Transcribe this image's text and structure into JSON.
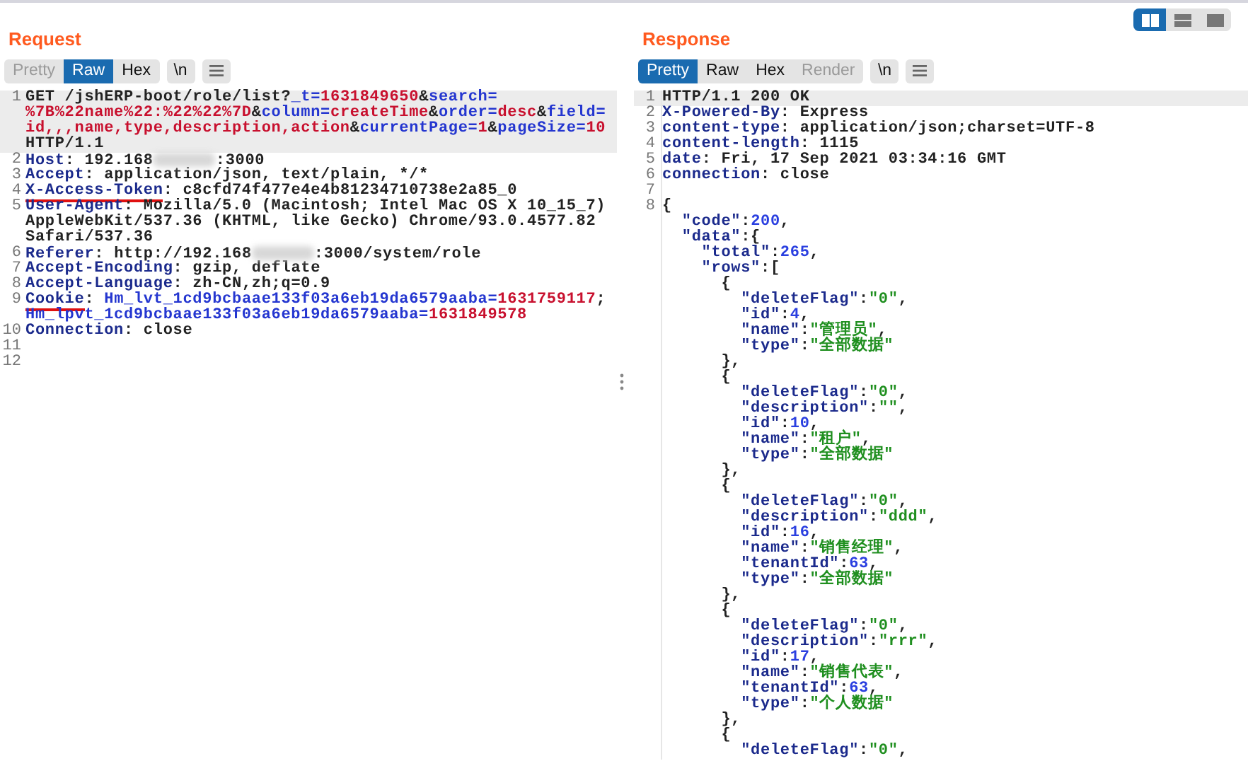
{
  "request": {
    "title": "Request",
    "tabs": [
      {
        "label": "Pretty",
        "selected": false,
        "disabled": true
      },
      {
        "label": "Raw",
        "selected": true,
        "disabled": false
      },
      {
        "label": "Hex",
        "selected": false,
        "disabled": false
      }
    ],
    "newline_button": "\\n",
    "lines": [
      {
        "number": "1",
        "highlighted": true,
        "rows": [
          {
            "segments": [
              {
                "kind": "plain",
                "text": "GET /jshERP-boot/role/list?"
              },
              {
                "kind": "param",
                "text": "_t="
              },
              {
                "kind": "value",
                "text": "1631849650"
              },
              {
                "kind": "plain",
                "text": "&"
              },
              {
                "kind": "param",
                "text": "search="
              }
            ]
          },
          {
            "segments": [
              {
                "kind": "value",
                "text": "%7B%22name%22:%22%22%7D"
              },
              {
                "kind": "plain",
                "text": "&"
              },
              {
                "kind": "param",
                "text": "column="
              },
              {
                "kind": "value",
                "text": "createTime"
              },
              {
                "kind": "plain",
                "text": "&"
              },
              {
                "kind": "param",
                "text": "order="
              },
              {
                "kind": "value",
                "text": "desc"
              },
              {
                "kind": "plain",
                "text": "&"
              },
              {
                "kind": "param",
                "text": "field="
              }
            ]
          },
          {
            "segments": [
              {
                "kind": "value",
                "text": "id,,,name,type,description,action"
              },
              {
                "kind": "plain",
                "text": "&"
              },
              {
                "kind": "param",
                "text": "currentPage="
              },
              {
                "kind": "value",
                "text": "1"
              },
              {
                "kind": "plain",
                "text": "&"
              },
              {
                "kind": "param",
                "text": "pageSize="
              },
              {
                "kind": "value",
                "text": "10"
              }
            ]
          },
          {
            "segments": [
              {
                "kind": "plain",
                "text": "HTTP/1.1"
              }
            ]
          }
        ]
      },
      {
        "number": "2",
        "highlighted": false,
        "rows": [
          {
            "segments": [
              {
                "kind": "key",
                "text": "Host"
              },
              {
                "kind": "plain",
                "text": ": 192.168"
              },
              {
                "kind": "blur"
              },
              {
                "kind": "plain",
                "text": ":3000"
              }
            ]
          }
        ]
      },
      {
        "number": "3",
        "highlighted": false,
        "rows": [
          {
            "segments": [
              {
                "kind": "key",
                "text": "Accept"
              },
              {
                "kind": "plain",
                "text": ": application/json, text/plain, */*"
              }
            ]
          }
        ]
      },
      {
        "number": "4",
        "highlighted": false,
        "rows": [
          {
            "segments": [
              {
                "kind": "key",
                "text": "X-Access-Token",
                "underlined": true
              },
              {
                "kind": "plain",
                "text": ": c8cfd74f477e4e4b81234710738e2a85_0"
              }
            ]
          }
        ]
      },
      {
        "number": "5",
        "highlighted": false,
        "rows": [
          {
            "segments": [
              {
                "kind": "key",
                "text": "User-Agent"
              },
              {
                "kind": "plain",
                "text": ": Mozilla/5.0 (Macintosh; Intel Mac OS X 10_15_7)"
              }
            ]
          },
          {
            "segments": [
              {
                "kind": "plain",
                "text": "AppleWebKit/537.36 (KHTML, like Gecko) Chrome/93.0.4577.82"
              }
            ]
          },
          {
            "segments": [
              {
                "kind": "plain",
                "text": "Safari/537.36"
              }
            ]
          }
        ]
      },
      {
        "number": "6",
        "highlighted": false,
        "rows": [
          {
            "segments": [
              {
                "kind": "key",
                "text": "Referer"
              },
              {
                "kind": "plain",
                "text": ": http://192.168"
              },
              {
                "kind": "blur"
              },
              {
                "kind": "plain",
                "text": ":3000/system/role"
              }
            ]
          }
        ]
      },
      {
        "number": "7",
        "highlighted": false,
        "rows": [
          {
            "segments": [
              {
                "kind": "key",
                "text": "Accept-Encoding"
              },
              {
                "kind": "plain",
                "text": ": gzip, deflate"
              }
            ]
          }
        ]
      },
      {
        "number": "8",
        "highlighted": false,
        "rows": [
          {
            "segments": [
              {
                "kind": "key",
                "text": "Accept-Language"
              },
              {
                "kind": "plain",
                "text": ": zh-CN,zh;q=0.9"
              }
            ]
          }
        ]
      },
      {
        "number": "9",
        "highlighted": false,
        "rows": [
          {
            "segments": [
              {
                "kind": "key",
                "text": "Cookie",
                "underlined": true
              },
              {
                "kind": "plain",
                "text": ": "
              },
              {
                "kind": "param",
                "text": "Hm_lvt_1cd9bcbaae133f03a6eb19da6579aaba="
              },
              {
                "kind": "value",
                "text": "1631759117"
              },
              {
                "kind": "plain",
                "text": ";"
              }
            ]
          },
          {
            "segments": [
              {
                "kind": "param",
                "text": "Hm_lpvt_1cd9bcbaae133f03a6eb19da6579aaba="
              },
              {
                "kind": "value",
                "text": "1631849578"
              }
            ]
          }
        ]
      },
      {
        "number": "10",
        "highlighted": false,
        "rows": [
          {
            "segments": [
              {
                "kind": "key",
                "text": "Connection"
              },
              {
                "kind": "plain",
                "text": ": close"
              }
            ]
          }
        ]
      },
      {
        "number": "11",
        "highlighted": false
      },
      {
        "number": "12",
        "highlighted": false
      }
    ]
  },
  "response": {
    "title": "Response",
    "layout_buttons": [
      {
        "selected": true
      },
      {
        "selected": false
      },
      {
        "selected": false
      }
    ],
    "tabs": [
      {
        "label": "Pretty",
        "selected": true,
        "disabled": false
      },
      {
        "label": "Raw",
        "selected": false,
        "disabled": false
      },
      {
        "label": "Hex",
        "selected": false,
        "disabled": false
      },
      {
        "label": "Render",
        "selected": false,
        "disabled": true
      }
    ],
    "newline_button": "\\n",
    "lines": [
      {
        "number": "1",
        "highlighted": true,
        "rows": [
          {
            "segments": [
              {
                "kind": "plain",
                "text": "HTTP/1.1 200 OK"
              }
            ]
          }
        ]
      },
      {
        "number": "2",
        "highlighted": false,
        "rows": [
          {
            "segments": [
              {
                "kind": "key",
                "text": "X-Powered-By"
              },
              {
                "kind": "plain",
                "text": ": Express"
              }
            ]
          }
        ]
      },
      {
        "number": "3",
        "highlighted": false,
        "rows": [
          {
            "segments": [
              {
                "kind": "key",
                "text": "content-type"
              },
              {
                "kind": "plain",
                "text": ": application/json;charset=UTF-8"
              }
            ]
          }
        ]
      },
      {
        "number": "4",
        "highlighted": false,
        "rows": [
          {
            "segments": [
              {
                "kind": "key",
                "text": "content-length"
              },
              {
                "kind": "plain",
                "text": ": 1115"
              }
            ]
          }
        ]
      },
      {
        "number": "5",
        "highlighted": false,
        "rows": [
          {
            "segments": [
              {
                "kind": "key",
                "text": "date"
              },
              {
                "kind": "plain",
                "text": ": Fri, 17 Sep 2021 03:34:16 GMT"
              }
            ]
          }
        ]
      },
      {
        "number": "6",
        "highlighted": false,
        "rows": [
          {
            "segments": [
              {
                "kind": "key",
                "text": "connection"
              },
              {
                "kind": "plain",
                "text": ": close"
              }
            ]
          }
        ]
      },
      {
        "number": "7",
        "highlighted": false
      },
      {
        "number": "8",
        "highlighted": false,
        "rows": [
          {
            "segments": [
              {
                "kind": "plain",
                "text": "{"
              }
            ]
          },
          {
            "segments": [
              {
                "kind": "key",
                "text": "  \"code\""
              },
              {
                "kind": "plain",
                "text": ":"
              },
              {
                "kind": "number",
                "text": "200"
              },
              {
                "kind": "plain",
                "text": ","
              }
            ]
          },
          {
            "segments": [
              {
                "kind": "key",
                "text": "  \"data\""
              },
              {
                "kind": "plain",
                "text": ":{"
              }
            ]
          },
          {
            "segments": [
              {
                "kind": "key",
                "text": "    \"total\""
              },
              {
                "kind": "plain",
                "text": ":"
              },
              {
                "kind": "number",
                "text": "265"
              },
              {
                "kind": "plain",
                "text": ","
              }
            ]
          },
          {
            "segments": [
              {
                "kind": "key",
                "text": "    \"rows\""
              },
              {
                "kind": "plain",
                "text": ":["
              }
            ]
          },
          {
            "segments": [
              {
                "kind": "plain",
                "text": "      {"
              }
            ]
          },
          {
            "segments": [
              {
                "kind": "key",
                "text": "        \"deleteFlag\""
              },
              {
                "kind": "plain",
                "text": ":"
              },
              {
                "kind": "string",
                "text": "\"0\""
              },
              {
                "kind": "plain",
                "text": ","
              }
            ]
          },
          {
            "segments": [
              {
                "kind": "key",
                "text": "        \"id\""
              },
              {
                "kind": "plain",
                "text": ":"
              },
              {
                "kind": "number",
                "text": "4"
              },
              {
                "kind": "plain",
                "text": ","
              }
            ]
          },
          {
            "segments": [
              {
                "kind": "key",
                "text": "        \"name\""
              },
              {
                "kind": "plain",
                "text": ":"
              },
              {
                "kind": "string",
                "text": "\"管理员\""
              },
              {
                "kind": "plain",
                "text": ","
              }
            ]
          },
          {
            "segments": [
              {
                "kind": "key",
                "text": "        \"type\""
              },
              {
                "kind": "plain",
                "text": ":"
              },
              {
                "kind": "string",
                "text": "\"全部数据\""
              }
            ]
          },
          {
            "segments": [
              {
                "kind": "plain",
                "text": "      },"
              }
            ]
          },
          {
            "segments": [
              {
                "kind": "plain",
                "text": "      {"
              }
            ]
          },
          {
            "segments": [
              {
                "kind": "key",
                "text": "        \"deleteFlag\""
              },
              {
                "kind": "plain",
                "text": ":"
              },
              {
                "kind": "string",
                "text": "\"0\""
              },
              {
                "kind": "plain",
                "text": ","
              }
            ]
          },
          {
            "segments": [
              {
                "kind": "key",
                "text": "        \"description\""
              },
              {
                "kind": "plain",
                "text": ":"
              },
              {
                "kind": "string",
                "text": "\"\""
              },
              {
                "kind": "plain",
                "text": ","
              }
            ]
          },
          {
            "segments": [
              {
                "kind": "key",
                "text": "        \"id\""
              },
              {
                "kind": "plain",
                "text": ":"
              },
              {
                "kind": "number",
                "text": "10"
              },
              {
                "kind": "plain",
                "text": ","
              }
            ]
          },
          {
            "segments": [
              {
                "kind": "key",
                "text": "        \"name\""
              },
              {
                "kind": "plain",
                "text": ":"
              },
              {
                "kind": "string",
                "text": "\"租户\""
              },
              {
                "kind": "plain",
                "text": ","
              }
            ]
          },
          {
            "segments": [
              {
                "kind": "key",
                "text": "        \"type\""
              },
              {
                "kind": "plain",
                "text": ":"
              },
              {
                "kind": "string",
                "text": "\"全部数据\""
              }
            ]
          },
          {
            "segments": [
              {
                "kind": "plain",
                "text": "      },"
              }
            ]
          },
          {
            "segments": [
              {
                "kind": "plain",
                "text": "      {"
              }
            ]
          },
          {
            "segments": [
              {
                "kind": "key",
                "text": "        \"deleteFlag\""
              },
              {
                "kind": "plain",
                "text": ":"
              },
              {
                "kind": "string",
                "text": "\"0\""
              },
              {
                "kind": "plain",
                "text": ","
              }
            ]
          },
          {
            "segments": [
              {
                "kind": "key",
                "text": "        \"description\""
              },
              {
                "kind": "plain",
                "text": ":"
              },
              {
                "kind": "string",
                "text": "\"ddd\""
              },
              {
                "kind": "plain",
                "text": ","
              }
            ]
          },
          {
            "segments": [
              {
                "kind": "key",
                "text": "        \"id\""
              },
              {
                "kind": "plain",
                "text": ":"
              },
              {
                "kind": "number",
                "text": "16"
              },
              {
                "kind": "plain",
                "text": ","
              }
            ]
          },
          {
            "segments": [
              {
                "kind": "key",
                "text": "        \"name\""
              },
              {
                "kind": "plain",
                "text": ":"
              },
              {
                "kind": "string",
                "text": "\"销售经理\""
              },
              {
                "kind": "plain",
                "text": ","
              }
            ]
          },
          {
            "segments": [
              {
                "kind": "key",
                "text": "        \"tenantId\""
              },
              {
                "kind": "plain",
                "text": ":"
              },
              {
                "kind": "number",
                "text": "63"
              },
              {
                "kind": "plain",
                "text": ","
              }
            ]
          },
          {
            "segments": [
              {
                "kind": "key",
                "text": "        \"type\""
              },
              {
                "kind": "plain",
                "text": ":"
              },
              {
                "kind": "string",
                "text": "\"全部数据\""
              }
            ]
          },
          {
            "segments": [
              {
                "kind": "plain",
                "text": "      },"
              }
            ]
          },
          {
            "segments": [
              {
                "kind": "plain",
                "text": "      {"
              }
            ]
          },
          {
            "segments": [
              {
                "kind": "key",
                "text": "        \"deleteFlag\""
              },
              {
                "kind": "plain",
                "text": ":"
              },
              {
                "kind": "string",
                "text": "\"0\""
              },
              {
                "kind": "plain",
                "text": ","
              }
            ]
          },
          {
            "segments": [
              {
                "kind": "key",
                "text": "        \"description\""
              },
              {
                "kind": "plain",
                "text": ":"
              },
              {
                "kind": "string",
                "text": "\"rrr\""
              },
              {
                "kind": "plain",
                "text": ","
              }
            ]
          },
          {
            "segments": [
              {
                "kind": "key",
                "text": "        \"id\""
              },
              {
                "kind": "plain",
                "text": ":"
              },
              {
                "kind": "number",
                "text": "17"
              },
              {
                "kind": "plain",
                "text": ","
              }
            ]
          },
          {
            "segments": [
              {
                "kind": "key",
                "text": "        \"name\""
              },
              {
                "kind": "plain",
                "text": ":"
              },
              {
                "kind": "string",
                "text": "\"销售代表\""
              },
              {
                "kind": "plain",
                "text": ","
              }
            ]
          },
          {
            "segments": [
              {
                "kind": "key",
                "text": "        \"tenantId\""
              },
              {
                "kind": "plain",
                "text": ":"
              },
              {
                "kind": "number",
                "text": "63"
              },
              {
                "kind": "plain",
                "text": ","
              }
            ]
          },
          {
            "segments": [
              {
                "kind": "key",
                "text": "        \"type\""
              },
              {
                "kind": "plain",
                "text": ":"
              },
              {
                "kind": "string",
                "text": "\"个人数据\""
              }
            ]
          },
          {
            "segments": [
              {
                "kind": "plain",
                "text": "      },"
              }
            ]
          },
          {
            "segments": [
              {
                "kind": "plain",
                "text": "      {"
              }
            ]
          },
          {
            "segments": [
              {
                "kind": "key",
                "text": "        \"deleteFlag\""
              },
              {
                "kind": "plain",
                "text": ":"
              },
              {
                "kind": "string",
                "text": "\"0\""
              },
              {
                "kind": "plain",
                "text": ","
              }
            ]
          }
        ]
      }
    ]
  }
}
